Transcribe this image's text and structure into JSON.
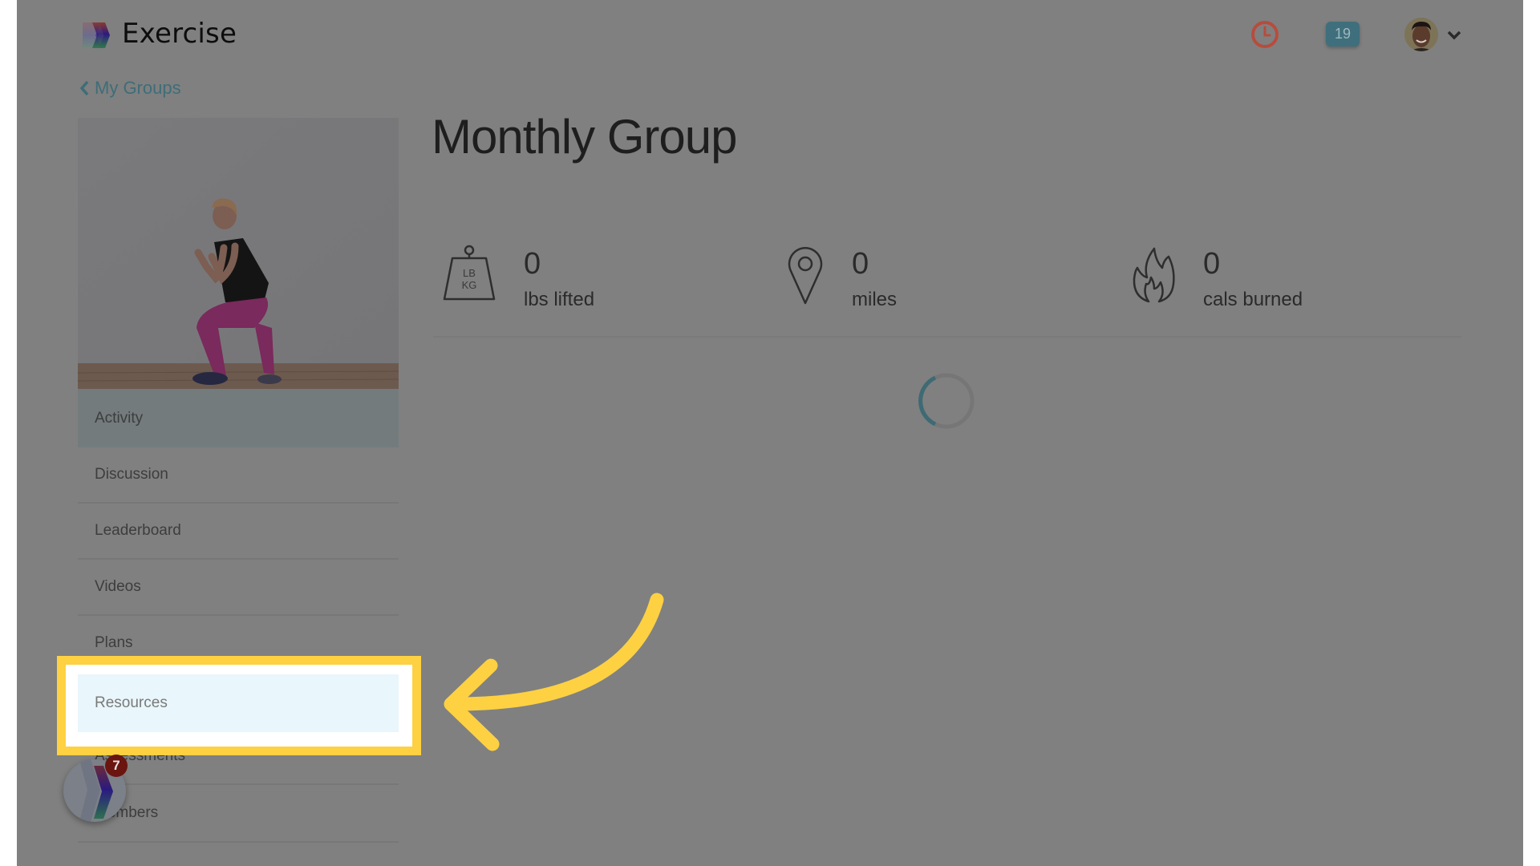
{
  "header": {
    "brand": "Exercise",
    "notification_count": "19",
    "icons": {
      "logo": "exercise-logo",
      "clock": "clock-icon",
      "avatar": "user-avatar",
      "menu": "chevron-down-icon"
    },
    "colors": {
      "clock": "#b84c3c",
      "badge": "#3f6f7c"
    }
  },
  "breadcrumb": {
    "back_label": "My Groups"
  },
  "group": {
    "title": "Monthly Group",
    "stats": [
      {
        "icon": "weight-icon",
        "value": "0",
        "label": "lbs lifted",
        "icon_text_top": "LB",
        "icon_text_bottom": "KG"
      },
      {
        "icon": "map-pin-icon",
        "value": "0",
        "label": "miles"
      },
      {
        "icon": "flame-icon",
        "value": "0",
        "label": "cals burned"
      }
    ]
  },
  "sidebar": {
    "items": [
      {
        "label": "Activity",
        "state": "active"
      },
      {
        "label": "Discussion"
      },
      {
        "label": "Leaderboard"
      },
      {
        "label": "Videos"
      },
      {
        "label": "Plans"
      },
      {
        "label": "Resources",
        "state": "highlighted"
      },
      {
        "label": "Assessments"
      },
      {
        "label": "Members"
      }
    ]
  },
  "launcher": {
    "badge_count": "7"
  },
  "annotation": {
    "highlight_color": "#fed142",
    "target": "Resources"
  }
}
